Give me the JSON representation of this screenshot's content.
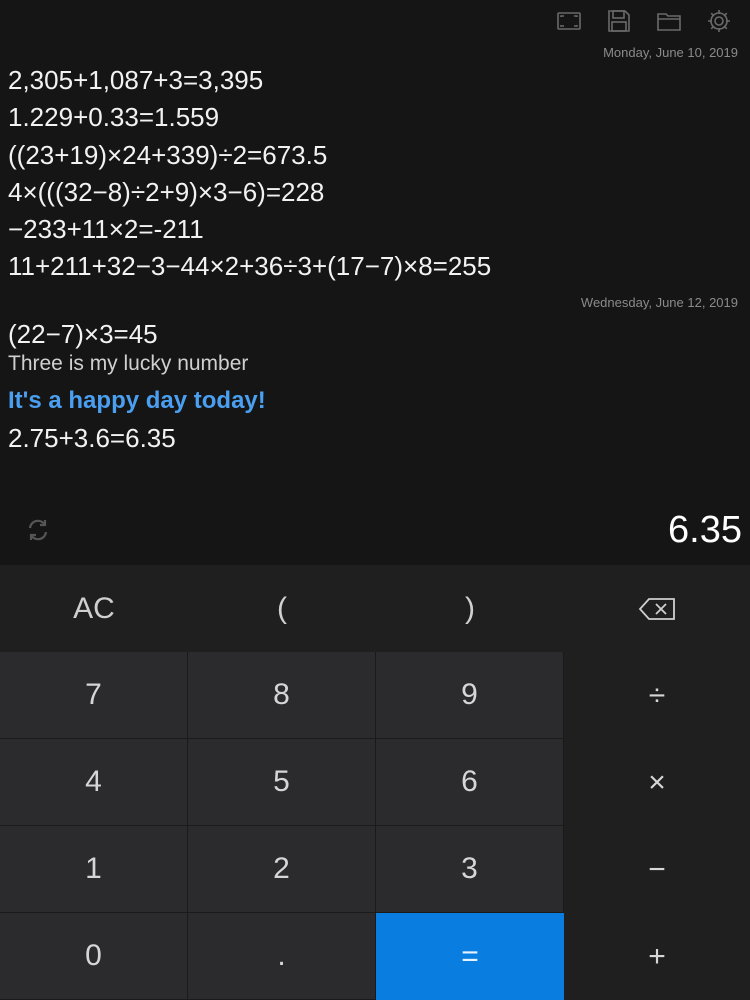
{
  "toolbar": {
    "icons": [
      "expand-icon",
      "save-icon",
      "folder-icon",
      "settings-icon"
    ]
  },
  "history": {
    "groups": [
      {
        "date": "Monday, June 10, 2019",
        "entries": [
          "2,305+1,087+3=3,395",
          "1.229+0.33=1.559",
          "((23+19)×24+339)÷2=673.5",
          "4×(((32−8)÷2+9)×3−6)=228",
          "−233+11×2=-211",
          "11+211+32−3−44×2+36÷3+(17−7)×8=255"
        ]
      },
      {
        "date": "Wednesday, June 12, 2019",
        "entries": [
          "(22−7)×3=45",
          "Three is my lucky number",
          "It's a happy day today!",
          "2.75+3.6=6.35"
        ]
      }
    ]
  },
  "display": {
    "result": "6.35",
    "refresh_icon": "refresh-icon"
  },
  "keys": {
    "ac": "AC",
    "lparen": "(",
    "rparen": ")",
    "backspace_icon": "backspace-icon",
    "seven": "7",
    "eight": "8",
    "nine": "9",
    "divide": "÷",
    "four": "4",
    "five": "5",
    "six": "6",
    "multiply": "×",
    "one": "1",
    "two": "2",
    "three": "3",
    "minus": "−",
    "zero": "0",
    "dot": ".",
    "equals": "=",
    "plus": "+"
  },
  "colors": {
    "background": "#151515",
    "keypad": "#1f1f1f",
    "number_key": "#2b2b2d",
    "equals_key": "#0a7ee0",
    "highlight_text": "#4a9ff0"
  }
}
